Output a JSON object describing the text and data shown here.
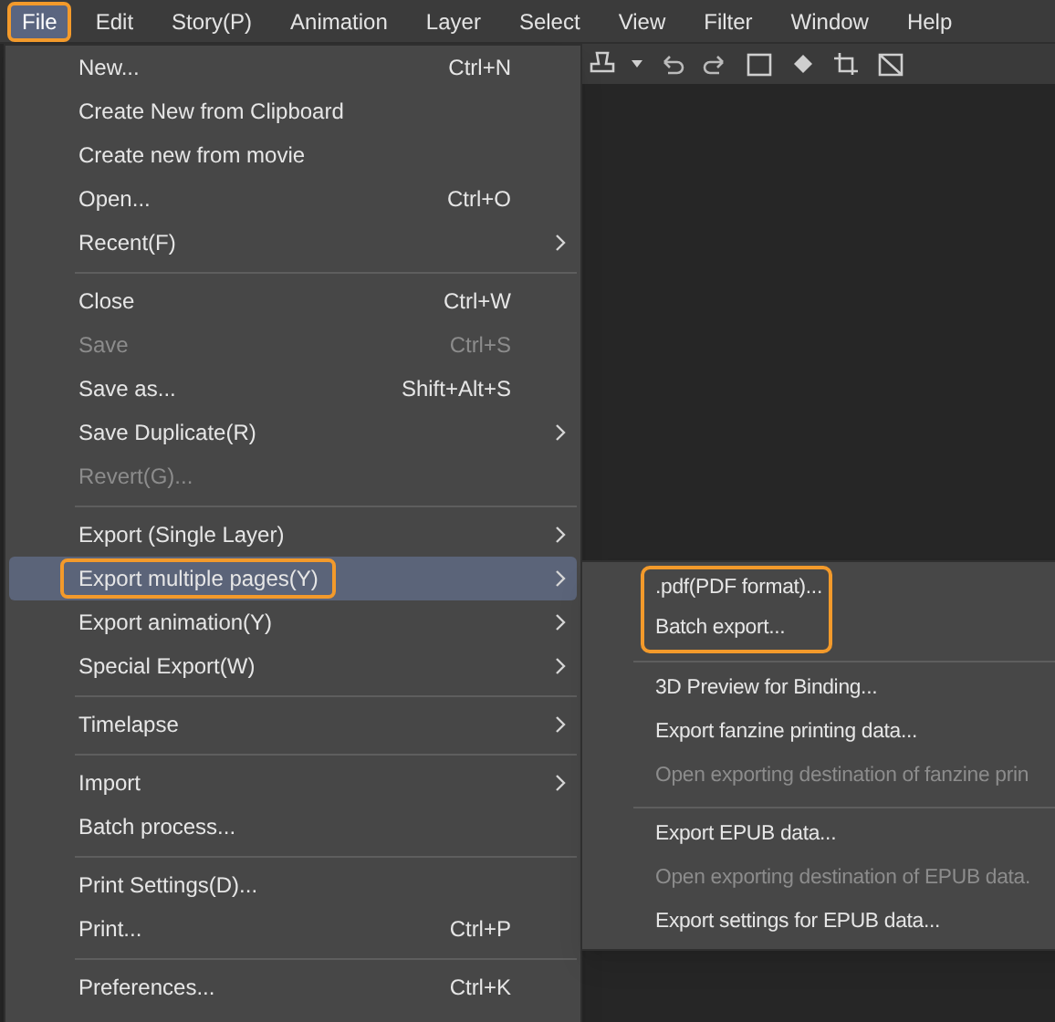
{
  "menu_bar": [
    {
      "label": "File",
      "selected": true,
      "outlined": true
    },
    {
      "label": "Edit",
      "selected": false,
      "outlined": false
    },
    {
      "label": "Story(P)",
      "selected": false,
      "outlined": false
    },
    {
      "label": "Animation",
      "selected": false,
      "outlined": false
    },
    {
      "label": "Layer",
      "selected": false,
      "outlined": false
    },
    {
      "label": "Select",
      "selected": false,
      "outlined": false
    },
    {
      "label": "View",
      "selected": false,
      "outlined": false
    },
    {
      "label": "Filter",
      "selected": false,
      "outlined": false
    },
    {
      "label": "Window",
      "selected": false,
      "outlined": false
    },
    {
      "label": "Help",
      "selected": false,
      "outlined": false
    }
  ],
  "file_menu": [
    {
      "kind": "item",
      "label": "New...",
      "shortcut": "Ctrl+N",
      "submenu": false,
      "disabled": false,
      "selected": false,
      "outlined": false
    },
    {
      "kind": "item",
      "label": "Create New from Clipboard",
      "submenu": false,
      "disabled": false,
      "selected": false,
      "outlined": false
    },
    {
      "kind": "item",
      "label": "Create new from movie",
      "submenu": false,
      "disabled": false,
      "selected": false,
      "outlined": false
    },
    {
      "kind": "item",
      "label": "Open...",
      "shortcut": "Ctrl+O",
      "submenu": false,
      "disabled": false,
      "selected": false,
      "outlined": false
    },
    {
      "kind": "item",
      "label": "Recent(F)",
      "submenu": true,
      "disabled": false,
      "selected": false,
      "outlined": false
    },
    {
      "kind": "separator"
    },
    {
      "kind": "item",
      "label": "Close",
      "shortcut": "Ctrl+W",
      "submenu": false,
      "disabled": false,
      "selected": false,
      "outlined": false
    },
    {
      "kind": "item",
      "label": "Save",
      "shortcut": "Ctrl+S",
      "submenu": false,
      "disabled": true,
      "selected": false,
      "outlined": false
    },
    {
      "kind": "item",
      "label": "Save as...",
      "shortcut": "Shift+Alt+S",
      "submenu": false,
      "disabled": false,
      "selected": false,
      "outlined": false
    },
    {
      "kind": "item",
      "label": "Save Duplicate(R)",
      "submenu": true,
      "disabled": false,
      "selected": false,
      "outlined": false
    },
    {
      "kind": "item",
      "label": "Revert(G)...",
      "submenu": false,
      "disabled": true,
      "selected": false,
      "outlined": false
    },
    {
      "kind": "separator"
    },
    {
      "kind": "item",
      "label": "Export (Single Layer)",
      "submenu": true,
      "disabled": false,
      "selected": false,
      "outlined": false
    },
    {
      "kind": "item",
      "label": "Export multiple pages(Y)",
      "submenu": true,
      "disabled": false,
      "selected": true,
      "outlined": true
    },
    {
      "kind": "item",
      "label": "Export animation(Y)",
      "submenu": true,
      "disabled": false,
      "selected": false,
      "outlined": false
    },
    {
      "kind": "item",
      "label": "Special Export(W)",
      "submenu": true,
      "disabled": false,
      "selected": false,
      "outlined": false
    },
    {
      "kind": "separator"
    },
    {
      "kind": "item",
      "label": "Timelapse",
      "submenu": true,
      "disabled": false,
      "selected": false,
      "outlined": false
    },
    {
      "kind": "separator"
    },
    {
      "kind": "item",
      "label": "Import",
      "submenu": true,
      "disabled": false,
      "selected": false,
      "outlined": false
    },
    {
      "kind": "item",
      "label": "Batch process...",
      "submenu": false,
      "disabled": false,
      "selected": false,
      "outlined": false
    },
    {
      "kind": "separator"
    },
    {
      "kind": "item",
      "label": "Print Settings(D)...",
      "submenu": false,
      "disabled": false,
      "selected": false,
      "outlined": false
    },
    {
      "kind": "item",
      "label": "Print...",
      "shortcut": "Ctrl+P",
      "submenu": false,
      "disabled": false,
      "selected": false,
      "outlined": false
    },
    {
      "kind": "separator"
    },
    {
      "kind": "item",
      "label": "Preferences...",
      "shortcut": "Ctrl+K",
      "submenu": false,
      "disabled": false,
      "selected": false,
      "outlined": false
    }
  ],
  "submenu": [
    {
      "kind": "item",
      "label": ".pdf(PDF format)...",
      "disabled": false,
      "outlined": true
    },
    {
      "kind": "item",
      "label": "Batch export...",
      "disabled": false,
      "outlined": true
    },
    {
      "kind": "separator"
    },
    {
      "kind": "item",
      "label": "3D Preview for Binding...",
      "disabled": false,
      "outlined": false
    },
    {
      "kind": "item",
      "label": "Export fanzine printing data...",
      "disabled": false,
      "outlined": false
    },
    {
      "kind": "item",
      "label": "Open exporting destination of fanzine prin",
      "disabled": true,
      "outlined": false
    },
    {
      "kind": "separator"
    },
    {
      "kind": "item",
      "label": "Export EPUB data...",
      "disabled": false,
      "outlined": false
    },
    {
      "kind": "item",
      "label": "Open exporting destination of EPUB data.",
      "disabled": true,
      "outlined": false
    },
    {
      "kind": "item",
      "label": "Export settings for EPUB data...",
      "disabled": false,
      "outlined": false
    }
  ]
}
